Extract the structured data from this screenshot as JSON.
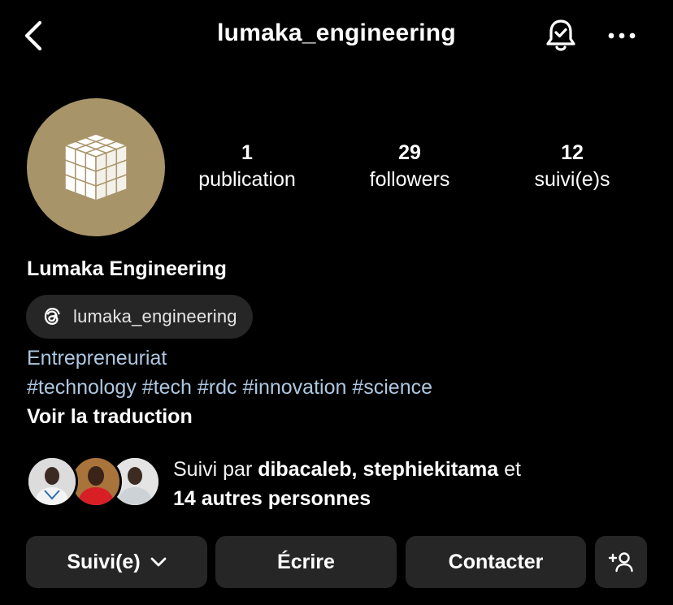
{
  "header": {
    "username": "lumaka_engineering",
    "back_icon": "chevron-left-icon",
    "notification_icon": "bell-check-icon",
    "more_icon": "ellipsis-icon"
  },
  "profile": {
    "avatar_icon": "cube-logo-icon",
    "avatar_color": "#a89469",
    "display_name": "Lumaka Engineering",
    "threads_handle": "lumaka_engineering",
    "category": "Entrepreneuriat",
    "hashtags": [
      "#technology",
      "#tech",
      "#rdc",
      "#innovation",
      "#science"
    ],
    "translate_label": "Voir la traduction"
  },
  "stats": {
    "posts": {
      "count": "1",
      "label": "publication"
    },
    "followers": {
      "count": "29",
      "label": "followers"
    },
    "following": {
      "count": "12",
      "label": "suivi(e)s"
    }
  },
  "mutuals": {
    "prefix": "Suivi par ",
    "user1": "dibacaleb",
    "separator": ", ",
    "user2": "stephiekitama",
    "suffix": " et",
    "others": "14 autres personnes"
  },
  "actions": {
    "following_label": "Suivi(e)",
    "message_label": "Écrire",
    "contact_label": "Contacter",
    "add_user_icon": "add-user-icon"
  },
  "colors": {
    "background": "#000000",
    "button_bg": "#262626",
    "link": "#aec7e0"
  }
}
